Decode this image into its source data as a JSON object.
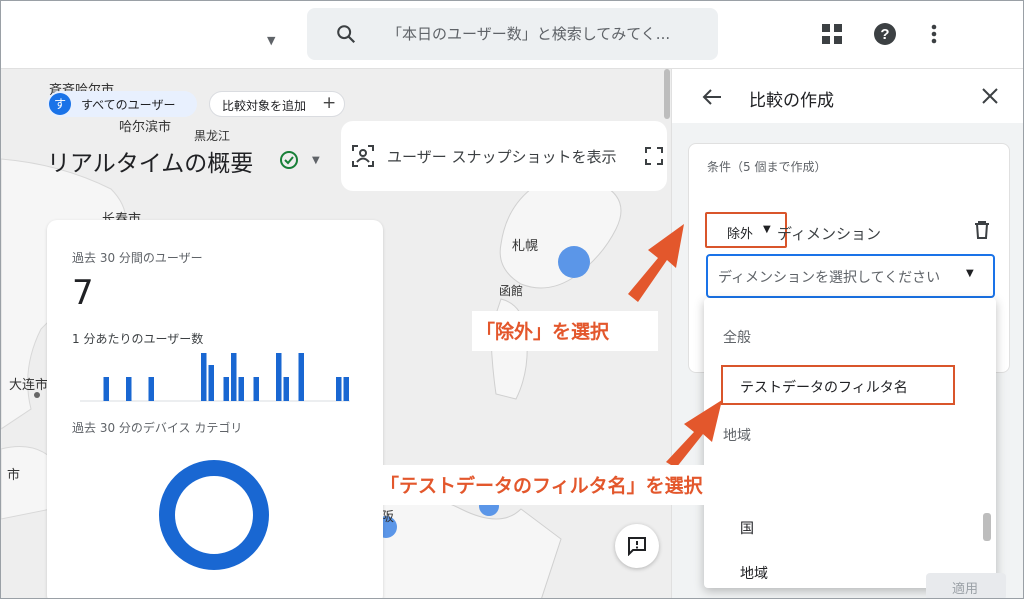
{
  "topbar": {
    "search_placeholder": "「本日のユーザー数」と検索してみてく..."
  },
  "map": {
    "labels": [
      "斉斉哈尔市",
      "哈尔滨市",
      "黒龙江",
      "长春市",
      "大连市",
      "札幌",
      "函館",
      "市",
      "阪"
    ]
  },
  "chips": {
    "avatar_letter": "す",
    "all_users": "すべてのユーザー",
    "add_compare": "比較対象を追加",
    "plus": "+"
  },
  "page": {
    "title": "リアルタイムの概要",
    "snapshot_label": "ユーザー スナップショットを表示"
  },
  "card": {
    "users_label": "過去 30 分間のユーザー",
    "users_value": "7",
    "per_minute_label": "1 分あたりのユーザー数",
    "per_minute_values": [
      0,
      0,
      0,
      2,
      0,
      0,
      2,
      0,
      0,
      2,
      0,
      0,
      0,
      0,
      0,
      0,
      4,
      3,
      0,
      2,
      4,
      2,
      0,
      2,
      0,
      0,
      4,
      2,
      0,
      4,
      0,
      0,
      0,
      0,
      2,
      2
    ],
    "device_label": "過去 30 分のデバイス カテゴリ"
  },
  "panel": {
    "title": "比較の作成",
    "condition_hint": "条件（5 個まで作成）",
    "exclude_label": "除外",
    "dimension_label": "ディメンション",
    "select_placeholder": "ディメンションを選択してください",
    "dropdown": {
      "group_general": "全般",
      "option_test_data": "テストデータのフィルタ名",
      "group_region": "地域",
      "option_country": "国",
      "option_region": "地域"
    },
    "apply_label": "適用"
  },
  "annotations": {
    "callout_exclude": "「除外」を選択",
    "callout_test_data": "「テストデータのフィルタ名」を選択",
    "color": "#e3572c"
  }
}
